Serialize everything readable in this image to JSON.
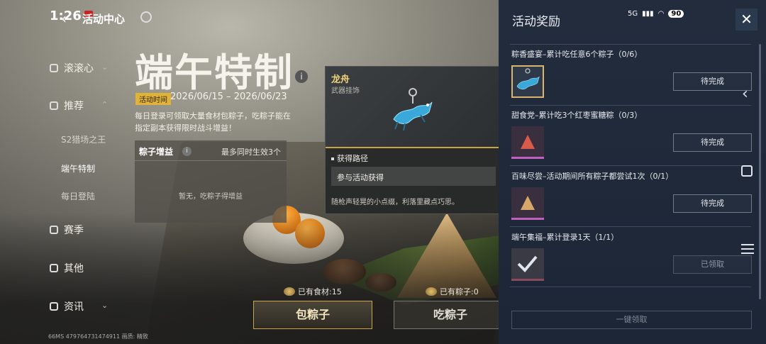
{
  "status_bar": {
    "time": "1:26",
    "network": "5G",
    "battery": "90"
  },
  "header": {
    "title": "活动中心"
  },
  "nav": {
    "items": [
      {
        "label": "滚滚心"
      },
      {
        "label": "推荐"
      },
      {
        "label": "赛季"
      },
      {
        "label": "其他"
      },
      {
        "label": "资讯"
      }
    ],
    "sub_items": [
      {
        "label": "S2猎场之王"
      },
      {
        "label": "端午特制"
      },
      {
        "label": "每日登陆"
      }
    ]
  },
  "event": {
    "title": "端午特制",
    "time_label": "活动时间",
    "time_range": "2026/06/15 – 2026/06/23",
    "description": "每日登录可领取大量食材包粽子，吃粽子能在指定副本获得限时战斗增益！",
    "buff_title": "粽子增益",
    "buff_max": "最多同时生效3个",
    "buff_empty": "暂无，吃粽子得增益",
    "ingredients_count": "已有食材:15",
    "zongzi_count": "已有粽子:0",
    "make_button": "包粽子",
    "eat_button": "吃粽子",
    "footer": "66MS  479764731474911  画质: 精致"
  },
  "tooltip": {
    "name": "龙舟",
    "type": "武器挂饰",
    "path_title": "获得路径",
    "path_value": "参与活动获得",
    "flavor": "随枪声轻晃的小点缀，利落里藏点巧思。"
  },
  "rewards_panel": {
    "title": "活动奖励",
    "close": "✕",
    "tasks": [
      {
        "title": "粽香盛宴–累计吃任意6个粽子（0/6）",
        "status": "待完成",
        "icon": "dragon-charm-icon"
      },
      {
        "title": "甜食党–累计吃3个红枣蜜糖粽（0/3）",
        "status": "待完成",
        "icon": "zongzi-red-icon"
      },
      {
        "title": "百味尽尝–活动期间所有粽子都尝试1次（0/1）",
        "status": "待完成",
        "icon": "zongzi-orange-icon"
      },
      {
        "title": "端午集福–累计登录1天（1/1）",
        "status": "已领取",
        "icon": "checkmark-icon"
      }
    ],
    "claim_all": "一键领取"
  },
  "colors": {
    "accent_gold": "#c9a24a",
    "panel_bg": "#1f2a3a",
    "time_tag": "#e0b238"
  }
}
